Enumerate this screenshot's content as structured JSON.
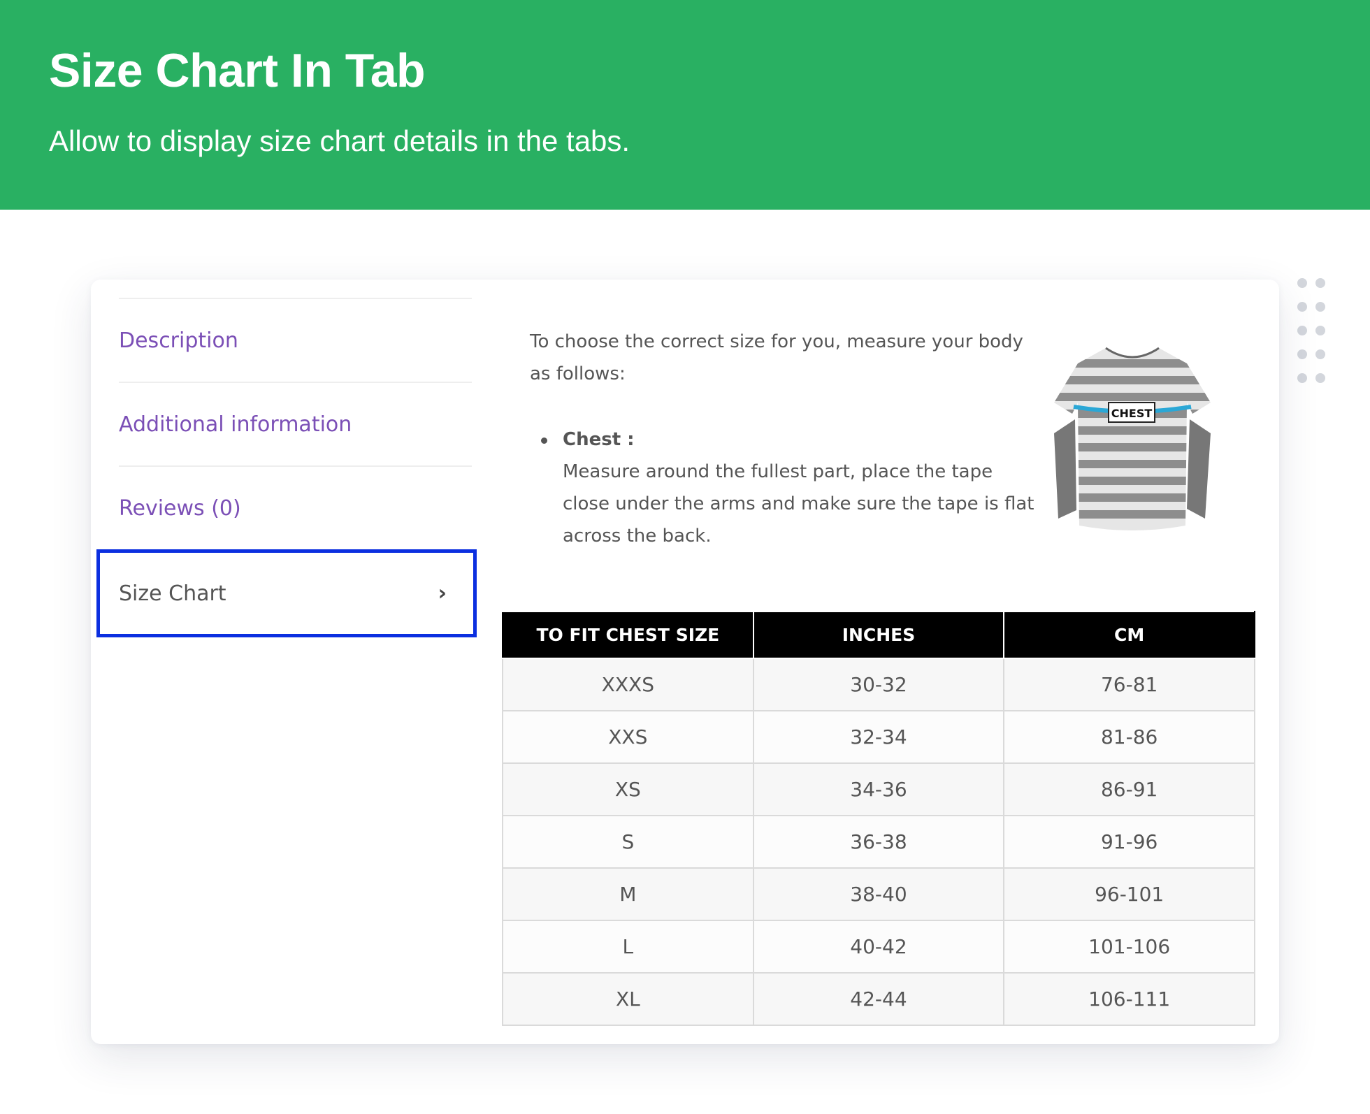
{
  "hero": {
    "title": "Size Chart In Tab",
    "subtitle": "Allow to display size chart details in the tabs."
  },
  "colors": {
    "hero_bg": "#29b062",
    "tab_link": "#7b4fb6",
    "active_outline": "#0b2fe0",
    "table_header_bg": "#000000"
  },
  "tabs": [
    {
      "label": "Description"
    },
    {
      "label": "Additional information"
    },
    {
      "label": "Reviews (0)"
    },
    {
      "label": "Size Chart",
      "active": true,
      "icon": "chevron-right-icon",
      "glyph": "›"
    }
  ],
  "content": {
    "intro": "To choose the correct size for you, measure your body as follows:",
    "bullet_title": "Chest :",
    "bullet_text": "Measure around the fullest part, place the tape close under the arms and make sure the tape is flat across the back.",
    "image_label": "CHEST"
  },
  "table": {
    "headers": [
      "TO FIT CHEST SIZE",
      "INCHES",
      "CM"
    ],
    "rows": [
      [
        "XXXS",
        "30-32",
        "76-81"
      ],
      [
        "XXS",
        "32-34",
        "81-86"
      ],
      [
        "XS",
        "34-36",
        "86-91"
      ],
      [
        "S",
        "36-38",
        "91-96"
      ],
      [
        "M",
        "38-40",
        "96-101"
      ],
      [
        "L",
        "40-42",
        "101-106"
      ],
      [
        "XL",
        "42-44",
        "106-111"
      ]
    ]
  }
}
